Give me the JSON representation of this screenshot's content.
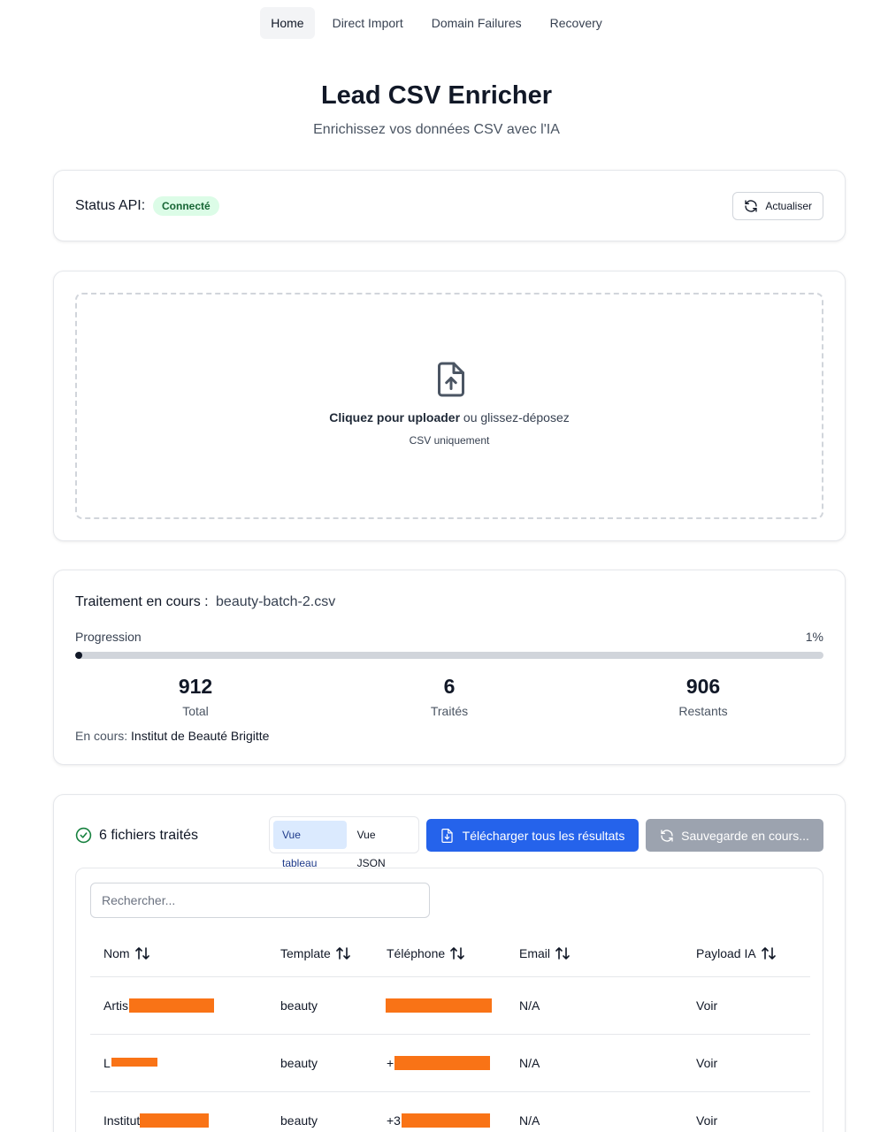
{
  "nav": {
    "items": [
      "Home",
      "Direct Import",
      "Domain Failures",
      "Recovery"
    ],
    "active": 0
  },
  "header": {
    "title": "Lead CSV Enricher",
    "subtitle": "Enrichissez vos données CSV avec l'IA"
  },
  "status": {
    "label": "Status API:",
    "badge": "Connecté",
    "refresh_label": "Actualiser"
  },
  "upload": {
    "cta_bold": "Cliquez pour uploader",
    "cta_rest": " ou glissez-déposez",
    "hint": "CSV uniquement"
  },
  "processing": {
    "title": "Traitement en cours :",
    "file": "beauty-batch-2.csv",
    "progress_label": "Progression",
    "progress_text": "1%",
    "progress_value": 0.01,
    "stats": [
      {
        "value": "912",
        "label": "Total"
      },
      {
        "value": "6",
        "label": "Traités"
      },
      {
        "value": "906",
        "label": "Restants"
      }
    ],
    "current_label": "En cours:",
    "current_value": "Institut de Beauté Brigitte"
  },
  "results": {
    "count_label": "6 fichiers traités",
    "view_table": "Vue tableau",
    "view_json": "Vue JSON",
    "download_label": "Télécharger tous les résultats",
    "saving_label": "Sauvegarde en cours...",
    "search_placeholder": "Rechercher...",
    "columns": [
      "Nom",
      "Template",
      "Téléphone",
      "Email",
      "Payload IA"
    ],
    "rows": [
      {
        "nom": "Artis",
        "template": "beauty",
        "telephone": "",
        "email": "N/A",
        "payload": "Voir"
      },
      {
        "nom": "L",
        "template": "beauty",
        "telephone": "+",
        "email": "N/A",
        "payload": "Voir"
      },
      {
        "nom": "Institut",
        "template": "beauty",
        "telephone": "+3",
        "email": "N/A",
        "payload": "Voir"
      }
    ]
  },
  "colors": {
    "accent": "#2563eb",
    "success_bg": "#dcfce7",
    "success_text": "#166534",
    "redaction": "#f97316"
  }
}
